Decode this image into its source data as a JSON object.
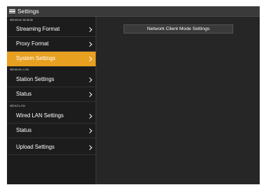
{
  "header": {
    "title": "Settings",
    "menu_icon": "hamburger-menu-icon"
  },
  "sidebar": {
    "sections": [
      {
        "label": "Wireless Module",
        "items": [
          {
            "label": "Streaming Format",
            "icon": "chevron-right-icon",
            "active": false
          },
          {
            "label": "Proxy Format",
            "icon": "chevron-right-icon",
            "active": false
          },
          {
            "label": "System Settings",
            "icon": "chevron-right-icon",
            "active": true
          }
        ]
      },
      {
        "label": "Wireless LAN",
        "items": [
          {
            "label": "Station Settings",
            "icon": "chevron-right-icon",
            "active": false
          },
          {
            "label": "Status",
            "icon": "chevron-right-icon",
            "active": false
          }
        ]
      },
      {
        "label": "Wired LAN",
        "items": [
          {
            "label": "Wired LAN Settings",
            "icon": "chevron-right-icon",
            "active": false
          },
          {
            "label": "Status",
            "icon": "chevron-right-icon",
            "active": false
          }
        ]
      },
      {
        "label": "",
        "items": [
          {
            "label": "Upload Settings",
            "icon": "chevron-right-icon",
            "active": false
          }
        ]
      }
    ]
  },
  "main": {
    "button_label": "Network Client Mode Settings"
  },
  "colors": {
    "accent": "#e8a020",
    "sidebar_bg": "#1c1c1c",
    "content_bg": "#262626",
    "titlebar_bg": "#3a3a3a"
  }
}
